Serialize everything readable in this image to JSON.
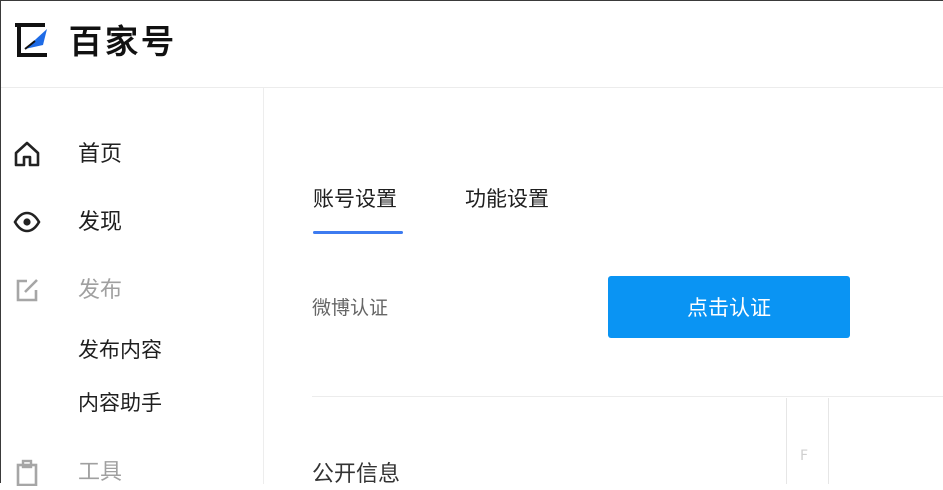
{
  "header": {
    "brand_name": "百家号",
    "logo_icon": "baijiahao-logo-icon"
  },
  "sidebar": {
    "items": [
      {
        "label": "首页",
        "icon": "home-icon"
      },
      {
        "label": "发现",
        "icon": "eye-icon"
      },
      {
        "label": "发布",
        "icon": "edit-icon",
        "muted": true
      },
      {
        "label": "工具",
        "icon": "clipboard-icon",
        "muted": true
      }
    ],
    "publish_sub": [
      "发布内容",
      "内容助手"
    ]
  },
  "main": {
    "tabs": [
      {
        "label": "账号设置",
        "active": true
      },
      {
        "label": "功能设置",
        "active": false
      }
    ],
    "weibo_label": "微博认证",
    "verify_button": "点击认证",
    "section_title": "公开信息",
    "fragment_glyph": "F"
  },
  "colors": {
    "accent_blue": "#0a94f3",
    "tab_underline": "#3d7bf0",
    "muted_text": "#a0a0a0"
  }
}
